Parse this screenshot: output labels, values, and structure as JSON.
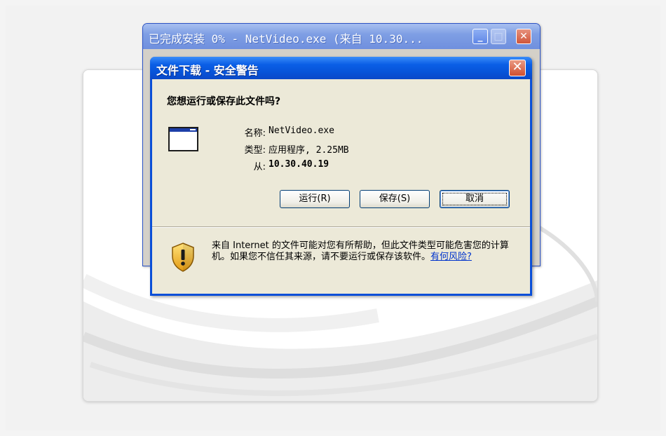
{
  "back_window": {
    "title": "已完成安装 0% - NetVideo.exe (来自 10.30...",
    "minimize_glyph": "_",
    "maximize_glyph": "□",
    "close_glyph": "✕"
  },
  "dialog": {
    "title": "文件下载 - 安全警告",
    "close_glyph": "✕",
    "question": "您想运行或保存此文件吗?",
    "file": {
      "icon": "application-window-icon",
      "name_label": "名称:",
      "name_value": "NetVideo.exe",
      "type_label": "类型:",
      "type_value": "应用程序, 2.25MB",
      "from_label": "从:",
      "from_value": "10.30.40.19"
    },
    "buttons": {
      "run": "运行(R)",
      "save": "保存(S)",
      "cancel": "取消"
    },
    "warning": {
      "icon": "security-shield-icon",
      "text": "来自 Internet 的文件可能对您有所帮助，但此文件类型可能危害您的计算机。如果您不信任其来源，请不要运行或保存该软件。",
      "link": "有何风险?"
    }
  },
  "colors": {
    "dialog_titlebar": "#0753d8",
    "dialog_body": "#ece9d8",
    "back_titlebar": "#7f9fe4",
    "link": "#0033cc"
  }
}
